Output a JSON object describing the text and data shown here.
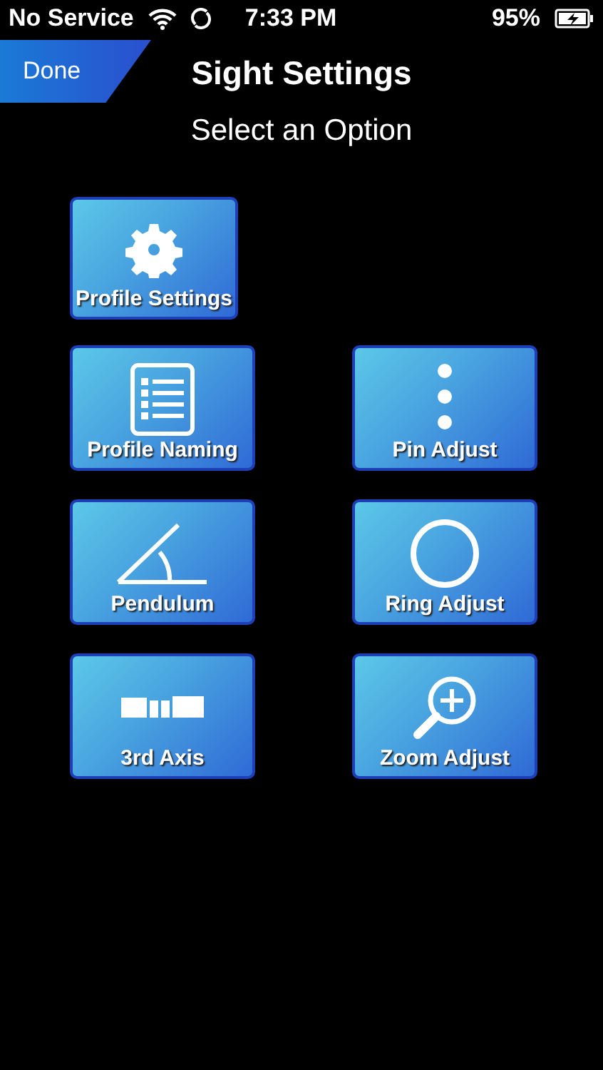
{
  "status_bar": {
    "carrier": "No Service",
    "time": "7:33 PM",
    "battery": "95%"
  },
  "nav": {
    "back_button": "Done",
    "title": "Sight Settings"
  },
  "subtitle": "Select an Option",
  "main_option": {
    "label": "Profile Settings",
    "kind": "gear"
  },
  "options": [
    {
      "label": "Profile Naming",
      "kind": "list"
    },
    {
      "label": "Pin Adjust",
      "kind": "pins"
    },
    {
      "label": "Pendulum",
      "kind": "angle"
    },
    {
      "label": "Ring Adjust",
      "kind": "ring"
    },
    {
      "label": "3rd Axis",
      "kind": "axis"
    },
    {
      "label": "Zoom Adjust",
      "kind": "zoom"
    }
  ]
}
